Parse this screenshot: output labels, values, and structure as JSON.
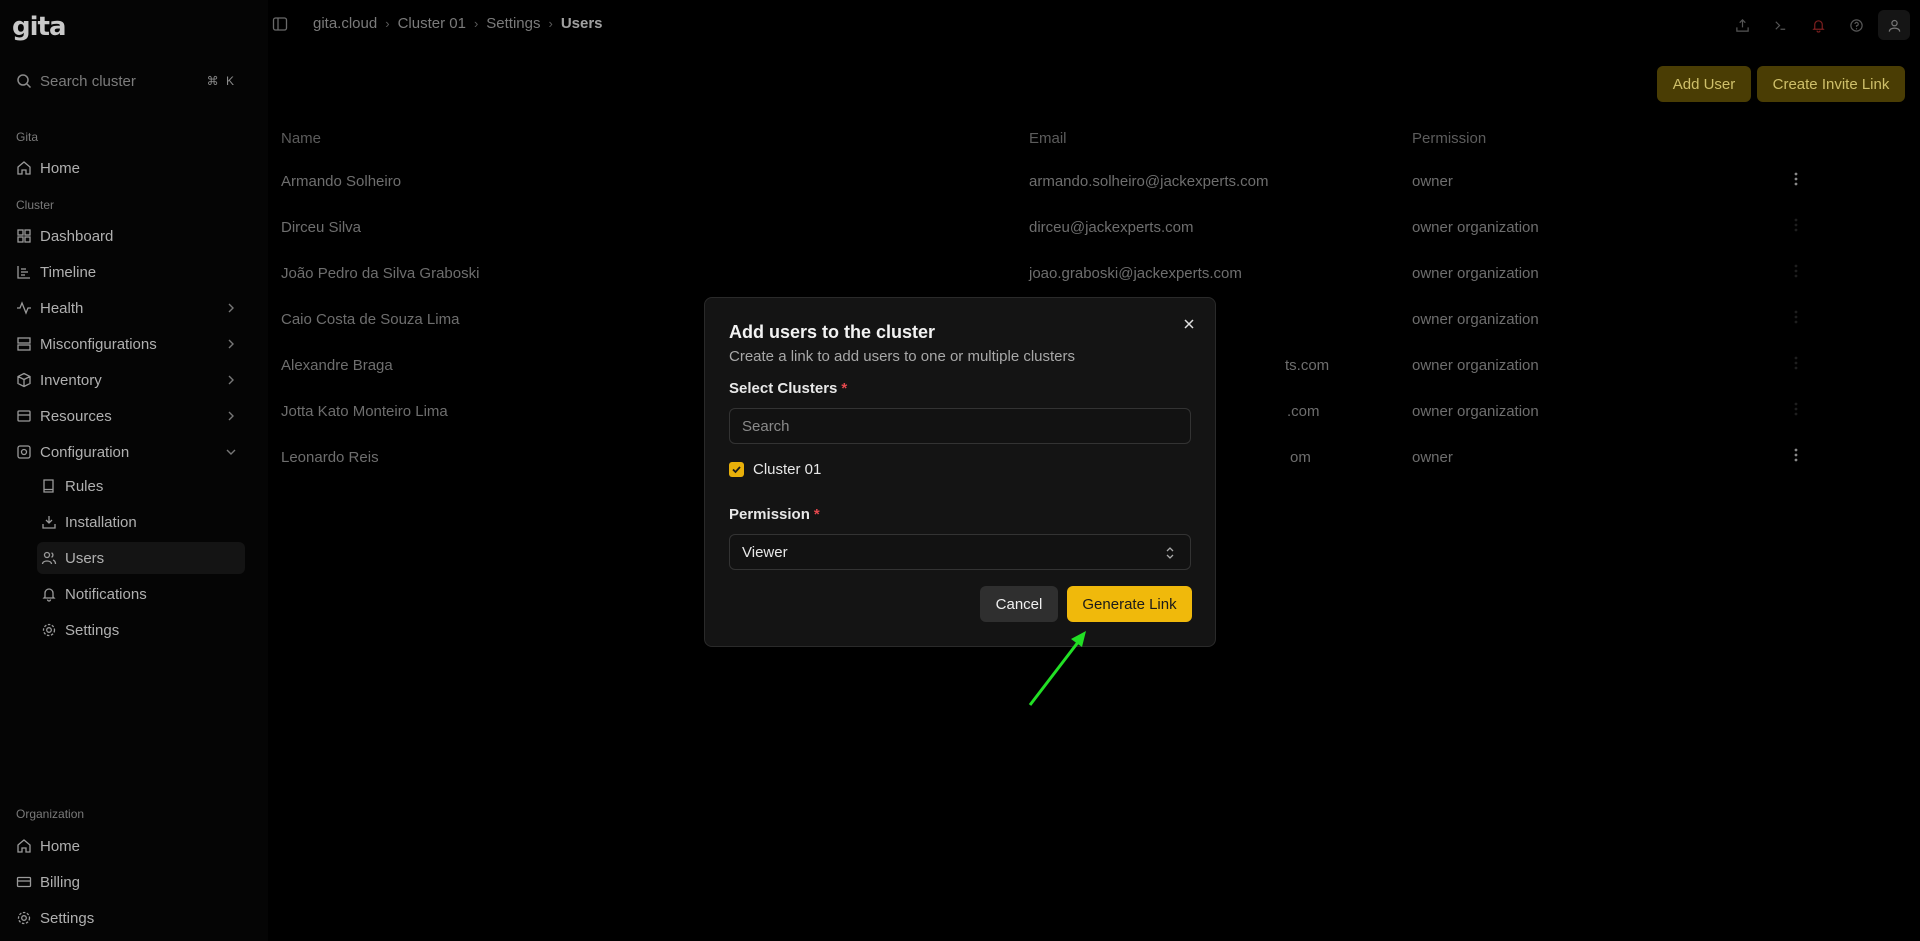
{
  "app": {
    "logo": "gita"
  },
  "sidebar": {
    "search_placeholder": "Search cluster",
    "search_shortcut": "⌘ K",
    "sections": {
      "gita": "Gita",
      "cluster": "Cluster",
      "organization": "Organization"
    },
    "gita_items": [
      {
        "label": "Home",
        "icon": "home-icon"
      }
    ],
    "cluster_items": [
      {
        "label": "Dashboard",
        "icon": "dashboard-icon"
      },
      {
        "label": "Timeline",
        "icon": "timeline-icon"
      },
      {
        "label": "Health",
        "icon": "health-icon"
      },
      {
        "label": "Misconfigurations",
        "icon": "misconfigurations-icon"
      },
      {
        "label": "Inventory",
        "icon": "inventory-icon"
      },
      {
        "label": "Resources",
        "icon": "resources-icon"
      },
      {
        "label": "Configuration",
        "icon": "configuration-icon"
      }
    ],
    "config_sub_items": [
      {
        "label": "Rules",
        "icon": "book-icon"
      },
      {
        "label": "Installation",
        "icon": "installation-icon"
      },
      {
        "label": "Users",
        "icon": "users-icon"
      },
      {
        "label": "Notifications",
        "icon": "bell-icon"
      },
      {
        "label": "Settings",
        "icon": "gear-icon"
      }
    ],
    "org_items": [
      {
        "label": "Home",
        "icon": "home-icon"
      },
      {
        "label": "Billing",
        "icon": "billing-icon"
      },
      {
        "label": "Settings",
        "icon": "gear-icon"
      }
    ]
  },
  "breadcrumb": [
    "gita.cloud",
    "Cluster 01",
    "Settings",
    "Users"
  ],
  "toolbar": {
    "add_user": "Add User",
    "create_invite_link": "Create Invite Link"
  },
  "table": {
    "headers": {
      "name": "Name",
      "email": "Email",
      "permission": "Permission"
    },
    "rows": [
      {
        "name": "Armando Solheiro",
        "email": "armando.solheiro@jackexperts.com",
        "permission": "owner"
      },
      {
        "name": "Dirceu Silva",
        "email": "dirceu@jackexperts.com",
        "permission": "owner organization"
      },
      {
        "name": "João Pedro da Silva Graboski",
        "email": "joao.graboski@jackexperts.com",
        "permission": "owner organization"
      },
      {
        "name": "Caio Costa de Souza Lima",
        "email": "",
        "permission": "owner organization"
      },
      {
        "name": "Alexandre Braga",
        "email": "ts.com",
        "permission": "owner organization"
      },
      {
        "name": "Jotta Kato Monteiro Lima",
        "email": ".com",
        "permission": "owner organization"
      },
      {
        "name": "Leonardo Reis",
        "email": "om",
        "permission": "owner"
      }
    ]
  },
  "modal": {
    "title": "Add users to the cluster",
    "description": "Create a link to add users to one or multiple clusters",
    "select_clusters_label": "Select Clusters",
    "required_mark": "*",
    "search_placeholder": "Search",
    "cluster_option": "Cluster 01",
    "permission_label": "Permission",
    "permission_value": "Viewer",
    "cancel": "Cancel",
    "generate": "Generate Link"
  },
  "colors": {
    "accent": "#f0b90b",
    "accent_dim": "#4a3d04",
    "annotation_arrow": "#22e025"
  }
}
